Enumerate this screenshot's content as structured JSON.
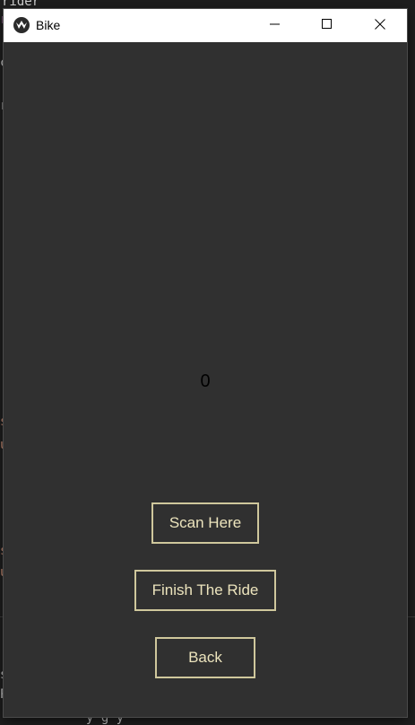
{
  "window": {
    "title": "Bike",
    "minimize_glyph": "—",
    "maximize_glyph": "☐",
    "close_glyph": "✕"
  },
  "main": {
    "counter": "0",
    "buttons": {
      "scan": "Scan Here",
      "finish": "Finish The Ride",
      "back": "Back"
    }
  },
  "colors": {
    "window_bg": "#303030",
    "button_border": "#cfc79c",
    "button_text": "#ece4bd",
    "titlebar_bg": "#ffffff"
  },
  "background_editor": {
    "fragments": [
      "rider",
      "r",
      "c",
      "r",
      "s",
      "u",
      "s",
      "u",
      "s",
      "P",
      "y g y"
    ]
  },
  "icons": {
    "app": "kivy-app-icon",
    "minimize": "minimize-icon",
    "maximize": "maximize-icon",
    "close": "close-icon"
  }
}
